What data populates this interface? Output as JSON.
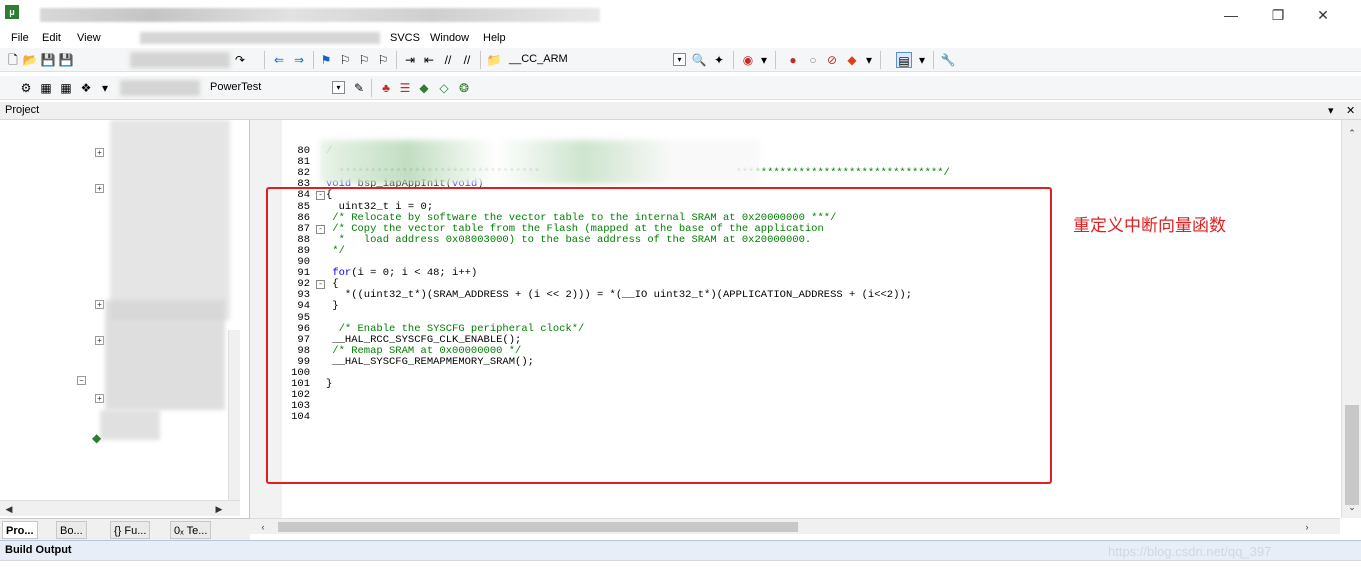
{
  "window": {
    "minimize": "—",
    "restore": "❐",
    "close": "✕"
  },
  "menu": {
    "file": "File",
    "edit": "Edit",
    "view": "View",
    "svcs": "SVCS",
    "window": "Window",
    "help": "Help"
  },
  "toolbar1": {
    "target_combo": "__CC_ARM"
  },
  "toolbar2": {
    "target_select": "PowerTest"
  },
  "project_panel": {
    "title": "Project",
    "tabs": [
      "Pro...",
      "Bo...",
      "{} Fu...",
      "0ₓ Te..."
    ]
  },
  "editor": {
    "annotation": "重定义中断向量函数",
    "lines": [
      {
        "n": "80",
        "code": "/",
        "type": "cm"
      },
      {
        "n": "81",
        "code": "",
        "type": "plain"
      },
      {
        "n": "82",
        "code": "  ********************************                               *********************************/",
        "type": "cm"
      },
      {
        "n": "83",
        "code": "void bsp_iapAppInit(void)",
        "type": "kw_fn"
      },
      {
        "n": "84",
        "code": "{",
        "type": "plain",
        "fold": "-"
      },
      {
        "n": "85",
        "code": "  uint32_t i = 0;",
        "type": "plain"
      },
      {
        "n": "86",
        "code": " /* Relocate by software the vector table to the internal SRAM at 0x20000000 ***/",
        "type": "cm"
      },
      {
        "n": "87",
        "code": " /* Copy the vector table from the Flash (mapped at the base of the application",
        "type": "cm",
        "fold": "-"
      },
      {
        "n": "88",
        "code": "  *   load address 0x08003000) to the base address of the SRAM at 0x20000000.",
        "type": "cm"
      },
      {
        "n": "89",
        "code": " */",
        "type": "cm"
      },
      {
        "n": "90",
        "code": "",
        "type": "plain"
      },
      {
        "n": "91",
        "code": " for(i = 0; i < 48; i++)",
        "type": "for"
      },
      {
        "n": "92",
        "code": " {",
        "type": "plain",
        "fold": "-"
      },
      {
        "n": "93",
        "code": "   *((uint32_t*)(SRAM_ADDRESS + (i << 2))) = *(__IO uint32_t*)(APPLICATION_ADDRESS + (i<<2));",
        "type": "plain"
      },
      {
        "n": "94",
        "code": " }",
        "type": "plain"
      },
      {
        "n": "95",
        "code": "",
        "type": "plain"
      },
      {
        "n": "96",
        "code": "  /* Enable the SYSCFG peripheral clock*/",
        "type": "cm"
      },
      {
        "n": "97",
        "code": " __HAL_RCC_SYSCFG_CLK_ENABLE();",
        "type": "plain"
      },
      {
        "n": "98",
        "code": " /* Remap SRAM at 0x00000000 */",
        "type": "cm"
      },
      {
        "n": "99",
        "code": " __HAL_SYSCFG_REMAPMEMORY_SRAM();",
        "type": "plain"
      },
      {
        "n": "100",
        "code": "",
        "type": "plain"
      },
      {
        "n": "101",
        "code": "}",
        "type": "plain"
      },
      {
        "n": "102",
        "code": "",
        "type": "plain"
      },
      {
        "n": "103",
        "code": "",
        "type": "plain"
      },
      {
        "n": "104",
        "code": "",
        "type": "plain"
      }
    ]
  },
  "build_output": {
    "title": "Build Output",
    "watermark": "https://blog.csdn.net/qq_397"
  }
}
